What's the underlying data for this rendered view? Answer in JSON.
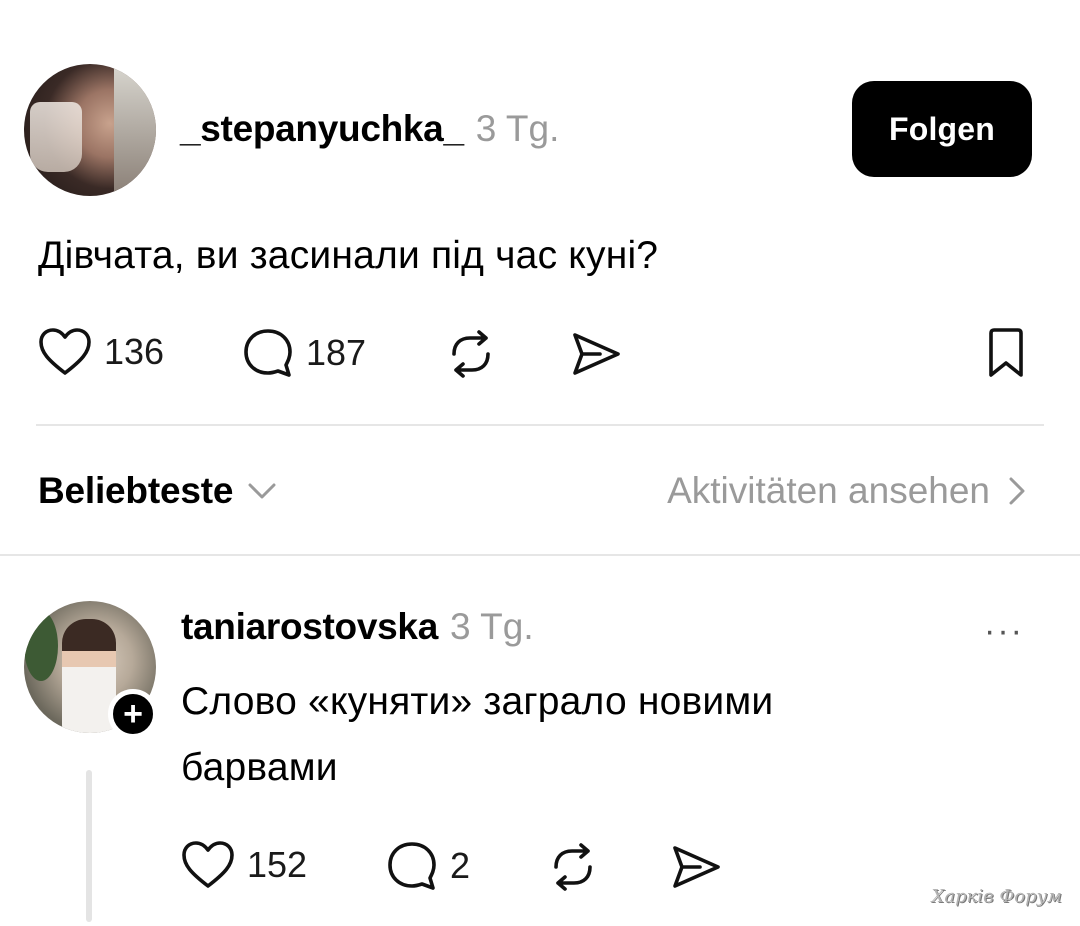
{
  "post": {
    "author": "_stepanyuchka_",
    "time": "3 Tg.",
    "follow_label": "Folgen",
    "text": "Дівчата, ви засинали під час куні?",
    "likes": "136",
    "comments": "187"
  },
  "sort": {
    "label": "Beliebteste",
    "activity_link": "Aktivitäten ansehen"
  },
  "reply": {
    "author": "taniarostovska",
    "time": "3 Tg.",
    "text": "Слово «куняти» заграло новими барвами",
    "likes": "152",
    "comments": "2",
    "more": "···"
  },
  "watermark": "Харків Форум",
  "icons": {
    "like": "heart-icon",
    "comment": "speech-bubble-icon",
    "repost": "repost-icon",
    "share": "send-icon",
    "save": "bookmark-icon",
    "chevron_down": "chevron-down-icon",
    "chevron_right": "chevron-right-icon",
    "add": "plus-icon",
    "more": "more-horizontal-icon"
  }
}
